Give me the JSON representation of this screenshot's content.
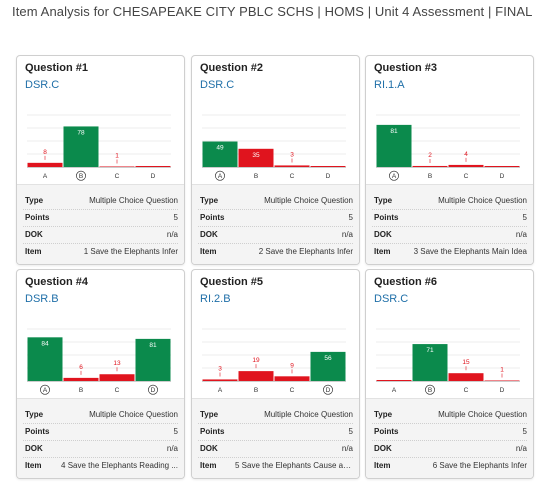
{
  "header": {
    "title": "Item Analysis for CHESAPEAKE CITY PBLC SCHS | HOMS | Unit 4 Assessment | FINAL"
  },
  "labels": {
    "type": "Type",
    "points": "Points",
    "dok": "DOK",
    "item": "Item"
  },
  "colors": {
    "correct": "#0b8a4c",
    "incorrect": "#e0141e",
    "standard_link": "#1f6fa8"
  },
  "questions": [
    {
      "title": "Question #1",
      "standard": "DSR.C",
      "type": "Multiple Choice Question",
      "points": "5",
      "dok": "n/a",
      "item": "1 Save the Elephants Infer",
      "chart_data": {
        "type": "bar",
        "categories": [
          "A",
          "B",
          "C",
          "D"
        ],
        "values": [
          8,
          78,
          1,
          0
        ],
        "value_labels": [
          "8",
          "78",
          "1",
          ""
        ],
        "correct": "B",
        "ylim": [
          0,
          100
        ]
      }
    },
    {
      "title": "Question #2",
      "standard": "DSR.C",
      "type": "Multiple Choice Question",
      "points": "5",
      "dok": "n/a",
      "item": "2 Save the Elephants Infer",
      "chart_data": {
        "type": "bar",
        "categories": [
          "A",
          "B",
          "C",
          "D"
        ],
        "values": [
          49,
          35,
          3,
          0
        ],
        "value_labels": [
          "49",
          "35",
          "3",
          ""
        ],
        "correct": "A",
        "ylim": [
          0,
          100
        ]
      }
    },
    {
      "title": "Question #3",
      "standard": "RI.1.A",
      "type": "Multiple Choice Question",
      "points": "5",
      "dok": "n/a",
      "item": "3 Save the Elephants Main Idea",
      "chart_data": {
        "type": "bar",
        "categories": [
          "A",
          "B",
          "C",
          "D"
        ],
        "values": [
          81,
          2,
          4,
          0
        ],
        "value_labels": [
          "81",
          "2",
          "4",
          ""
        ],
        "correct": "A",
        "ylim": [
          0,
          100
        ]
      }
    },
    {
      "title": "Question #4",
      "standard": "DSR.B",
      "type": "Multiple Choice Question",
      "points": "5",
      "dok": "n/a",
      "item": "4 Save the Elephants Reading ...",
      "chart_data": {
        "type": "bar",
        "categories": [
          "A",
          "B",
          "C",
          "D"
        ],
        "values": [
          84,
          6,
          13,
          81
        ],
        "value_labels": [
          "84",
          "6",
          "13",
          "81"
        ],
        "correct": [
          "A",
          "D"
        ],
        "ylim": [
          0,
          100
        ]
      }
    },
    {
      "title": "Question #5",
      "standard": "RI.2.B",
      "type": "Multiple Choice Question",
      "points": "5",
      "dok": "n/a",
      "item": "5 Save the Elephants Cause an...",
      "chart_data": {
        "type": "bar",
        "categories": [
          "A",
          "B",
          "C",
          "D"
        ],
        "values": [
          3,
          19,
          9,
          56
        ],
        "value_labels": [
          "3",
          "19",
          "9",
          "56"
        ],
        "correct": "D",
        "ylim": [
          0,
          100
        ]
      }
    },
    {
      "title": "Question #6",
      "standard": "DSR.C",
      "type": "Multiple Choice Question",
      "points": "5",
      "dok": "n/a",
      "item": "6 Save the Elephants Infer",
      "chart_data": {
        "type": "bar",
        "categories": [
          "A",
          "B",
          "C",
          "D"
        ],
        "values": [
          0,
          71,
          15,
          1
        ],
        "value_labels": [
          "",
          "71",
          "15",
          "1"
        ],
        "correct": "B",
        "ylim": [
          0,
          100
        ]
      }
    }
  ]
}
